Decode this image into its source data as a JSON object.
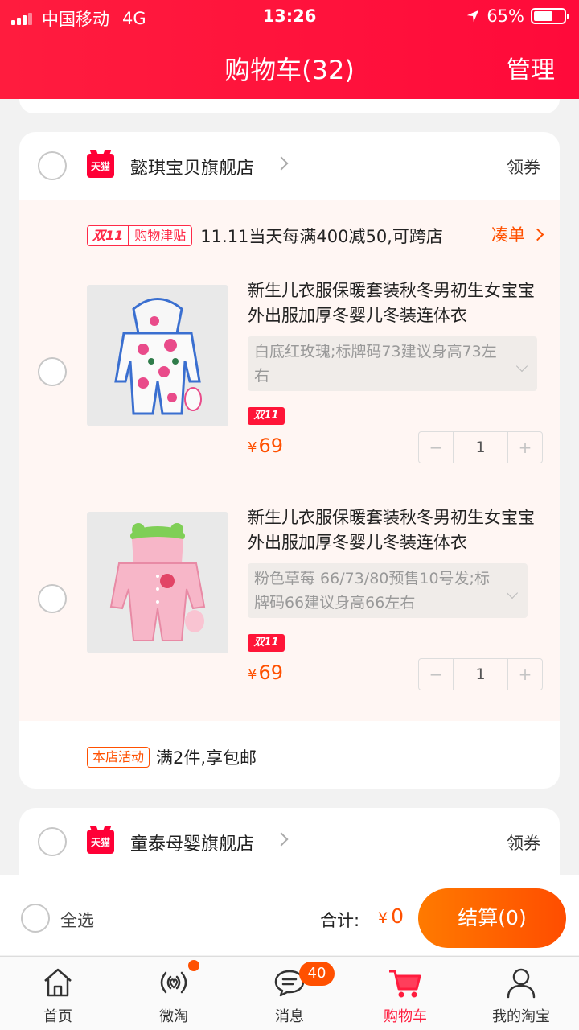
{
  "status_bar": {
    "carrier": "中国移动",
    "network": "4G",
    "time": "13:26",
    "battery": "65%",
    "battery_level": 0.65
  },
  "header": {
    "title": "购物车(32)",
    "manage": "管理"
  },
  "colors": {
    "brand_red": "#ff1c3e",
    "accent_orange": "#ff5000"
  },
  "shops": [
    {
      "name": "懿琪宝贝旗舰店",
      "badge": "天猫",
      "coupon": "领券",
      "promo": {
        "tag_left": "双11",
        "tag_right": "购物津贴",
        "text": "11.11当天每满400减50,可跨店",
        "action": "凑单"
      },
      "items": [
        {
          "title": "新生儿衣服保暖套装秋冬男初生女宝宝外出服加厚冬婴儿冬装连体衣",
          "sku": "白底红玫瑰;标牌码73建议身高73左右",
          "tag": "双11",
          "currency": "¥",
          "price": "69",
          "quantity": "1",
          "minus": "−",
          "plus": "+"
        },
        {
          "title": "新生儿衣服保暖套装秋冬男初生女宝宝外出服加厚冬婴儿冬装连体衣",
          "sku": "粉色草莓  66/73/80预售10号发;标牌码66建议身高66左右",
          "tag": "双11",
          "currency": "¥",
          "price": "69",
          "quantity": "1",
          "minus": "−",
          "plus": "+"
        }
      ],
      "store_activity": {
        "tag": "本店活动",
        "text": "满2件,享包邮"
      }
    },
    {
      "name": "童泰母婴旗舰店",
      "badge": "天猫",
      "coupon": "领券"
    }
  ],
  "checkout": {
    "select_all": "全选",
    "total_label": "合计:",
    "currency": "¥",
    "total": "0",
    "settle": "结算(0)"
  },
  "tabbar": {
    "tabs": [
      {
        "label": "首页",
        "icon": "home-icon"
      },
      {
        "label": "微淘",
        "icon": "broadcast-icon"
      },
      {
        "label": "消息",
        "icon": "message-icon",
        "badge": "40"
      },
      {
        "label": "购物车",
        "icon": "cart-icon",
        "active": true
      },
      {
        "label": "我的淘宝",
        "icon": "profile-icon"
      }
    ]
  }
}
